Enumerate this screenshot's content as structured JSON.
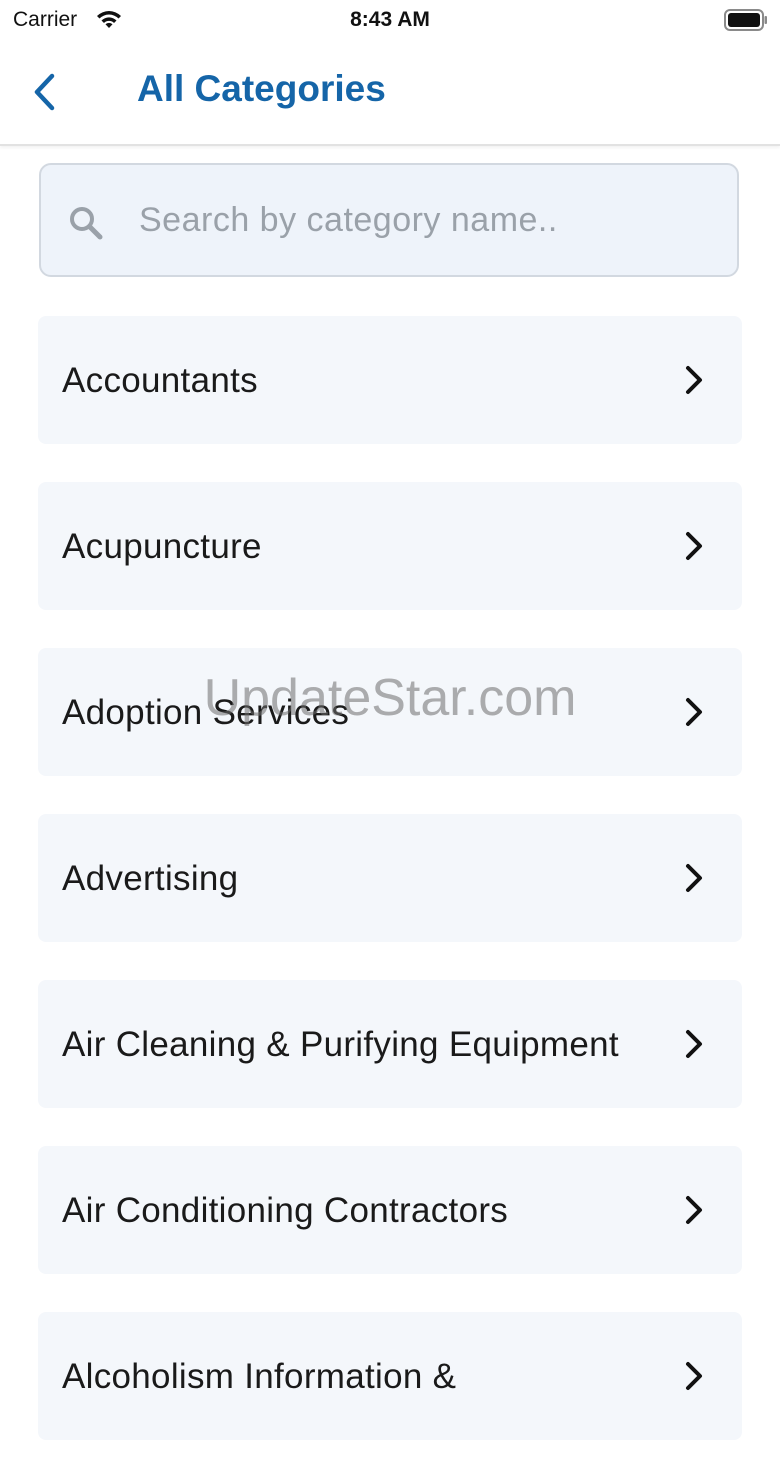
{
  "status_bar": {
    "carrier": "Carrier",
    "time": "8:43 AM"
  },
  "nav": {
    "title": "All Categories"
  },
  "search": {
    "placeholder": "Search by category name.."
  },
  "categories": [
    {
      "label": "Accountants"
    },
    {
      "label": "Acupuncture"
    },
    {
      "label": "Adoption Services"
    },
    {
      "label": "Advertising"
    },
    {
      "label": "Air Cleaning & Purifying Equipment"
    },
    {
      "label": "Air Conditioning Contractors"
    },
    {
      "label": "Alcoholism Information &"
    }
  ],
  "watermark": "UpdateStar.com",
  "colors": {
    "accent": "#1565a8",
    "card_bg": "#f4f7fb",
    "search_bg": "#eef3fa"
  }
}
